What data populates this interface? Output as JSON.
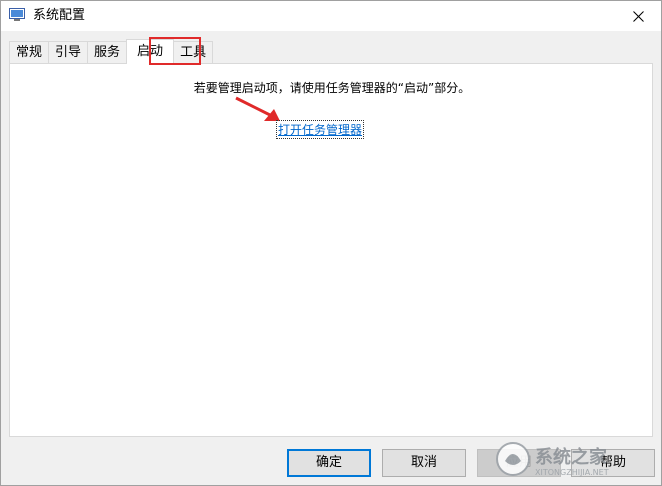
{
  "window": {
    "title": "系统配置"
  },
  "tabs": [
    {
      "label": "常规",
      "active": false
    },
    {
      "label": "引导",
      "active": false
    },
    {
      "label": "服务",
      "active": false
    },
    {
      "label": "启动",
      "active": true
    },
    {
      "label": "工具",
      "active": false
    }
  ],
  "startup_panel": {
    "message": "若要管理启动项，请使用任务管理器的“启动”部分。",
    "link_label": "打开任务管理器"
  },
  "buttons": {
    "ok": "确定",
    "cancel": "取消",
    "apply": "应用",
    "help": "帮助"
  },
  "colors": {
    "annotation": "#e02a2a",
    "link": "#0066cc",
    "focus": "#0078d7"
  },
  "watermark": {
    "text": "系统之家",
    "subtext": "XITONGZHIJIA.NET"
  }
}
